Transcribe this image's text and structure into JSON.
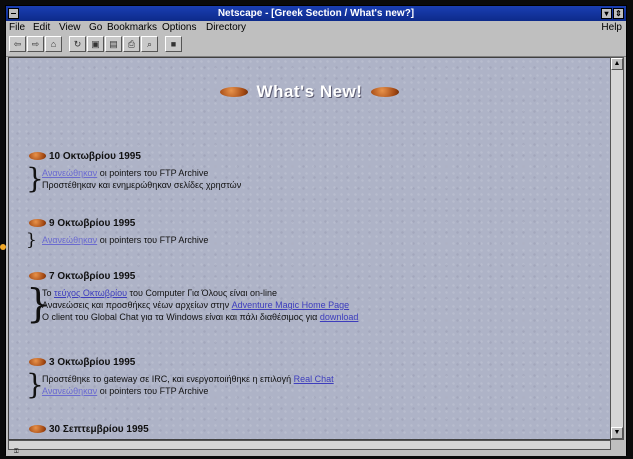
{
  "window": {
    "title": "Netscape - [Greek Section / What's new?]"
  },
  "menu": {
    "file": "File",
    "edit": "Edit",
    "view": "View",
    "go": "Go",
    "bookmarks": "Bookmarks",
    "options": "Options",
    "directory": "Directory",
    "help": "Help"
  },
  "toolbar_icons": [
    "back-icon",
    "forward-icon",
    "home-icon",
    "reload-icon",
    "images-icon",
    "open-icon",
    "print-icon",
    "find-icon",
    "stop-icon"
  ],
  "page": {
    "banner": "What's New!",
    "entries": [
      {
        "date": "10 Οκτωβρίου 1995",
        "lines": [
          {
            "link": "Ανανεώθηκαν",
            "text": " οι pointers του FTP Archive"
          },
          {
            "text": "Προστέθηκαν και ενημερώθηκαν σελίδες χρηστών"
          }
        ]
      },
      {
        "date": "9 Οκτωβρίου 1995",
        "lines": [
          {
            "link": "Ανανεώθηκαν",
            "text": " οι pointers του FTP Archive"
          }
        ]
      },
      {
        "date": "7 Οκτωβρίου 1995",
        "lines": [
          {
            "prefix": "Το ",
            "link": "τεύχος Οκτωβρίου",
            "text": " του Computer Για Όλους είναι on-line"
          },
          {
            "prefix": "Ανανεώσεις και προσθήκες νέων αρχείων στην ",
            "link": "Adventure Magic Home Page"
          },
          {
            "prefix": "O client του Global Chat για τα Windows είναι και πάλι διαθέσιμος για ",
            "link": "download"
          }
        ]
      },
      {
        "date": "3 Οκτωβρίου 1995",
        "lines": [
          {
            "prefix": "Προστέθηκε το gateway σε IRC, και ενεργοποιήθηκε η επιλογή ",
            "link": "Real Chat"
          },
          {
            "link": "Ανανεώθηκαν",
            "text": " οι pointers του FTP Archive"
          }
        ]
      },
      {
        "date": "30 Σεπτεμβρίου 1995",
        "lines": []
      }
    ]
  },
  "colors": {
    "titlebar": "#0d2a8a",
    "link": "#3d3dbd",
    "bullet": "#a34812"
  }
}
